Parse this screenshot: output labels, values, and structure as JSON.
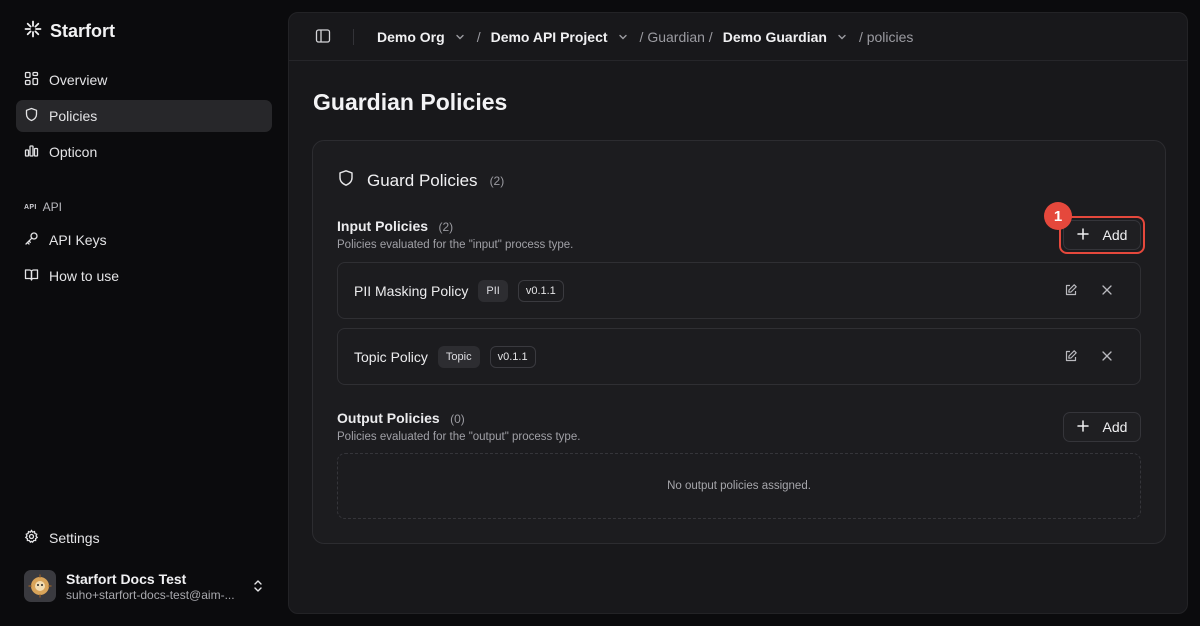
{
  "app": {
    "name": "Starfort"
  },
  "sidebar": {
    "items": [
      {
        "label": "Overview",
        "icon": "grid-icon"
      },
      {
        "label": "Policies",
        "icon": "shield-icon",
        "active": true
      },
      {
        "label": "Opticon",
        "icon": "bar-chart-icon"
      }
    ],
    "section_label": "API",
    "section_glyph": "API",
    "api_items": [
      {
        "label": "API Keys",
        "icon": "key-icon"
      },
      {
        "label": "How to use",
        "icon": "book-icon"
      }
    ],
    "settings_label": "Settings",
    "user": {
      "name": "Starfort Docs Test",
      "email": "suho+starfort-docs-test@aim-..."
    }
  },
  "breadcrumb": {
    "org": "Demo Org",
    "project": "Demo API Project",
    "guardian_seg": "/ Guardian /",
    "guardian": "Demo Guardian",
    "last": "/ policies",
    "separator": "/"
  },
  "page": {
    "title": "Guardian Policies"
  },
  "card": {
    "title": "Guard Policies",
    "count": "(2)",
    "input": {
      "title": "Input Policies",
      "count": "(2)",
      "subtitle": "Policies evaluated for the \"input\" process type.",
      "add_label": "Add",
      "policies": [
        {
          "name": "PII Masking Policy",
          "tag": "PII",
          "version": "v0.1.1"
        },
        {
          "name": "Topic Policy",
          "tag": "Topic",
          "version": "v0.1.1"
        }
      ]
    },
    "output": {
      "title": "Output Policies",
      "count": "(0)",
      "subtitle": "Policies evaluated for the \"output\" process type.",
      "add_label": "Add",
      "empty_text": "No output policies assigned."
    }
  },
  "annotation": {
    "marker": "1"
  },
  "colors": {
    "accent_highlight": "#e5483c",
    "background": "#0b0b0d",
    "panel": "#18181b"
  }
}
